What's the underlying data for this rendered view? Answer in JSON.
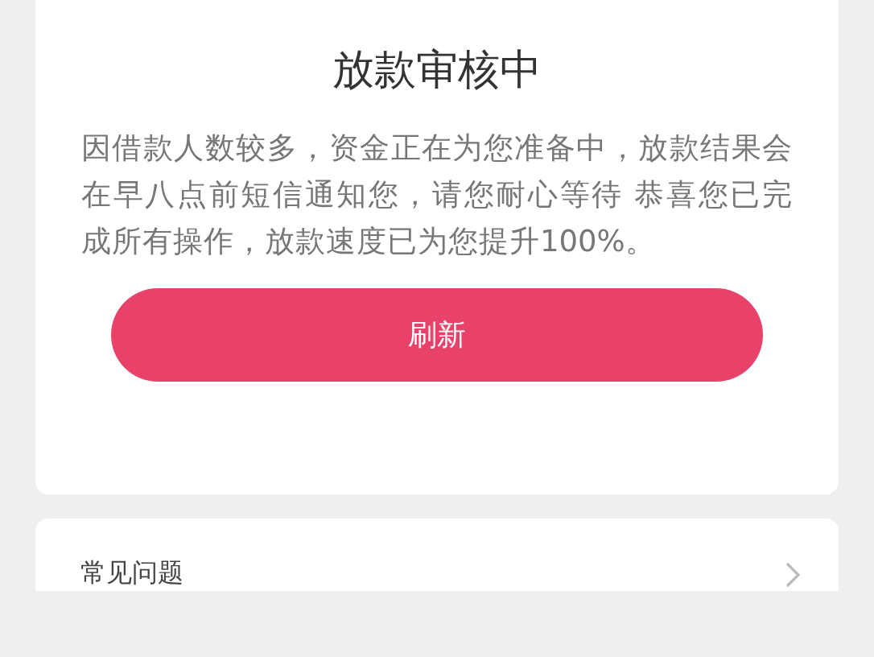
{
  "status_card": {
    "title": "放款审核中",
    "description": "因借款人数较多，资金正在为您准备中，放款结果会在早八点前短信通知您，请您耐心等待 恭喜您已完成所有操作，放款速度已为您提升100%。",
    "button": "刷新"
  },
  "faq_card": {
    "label": "常见问题"
  }
}
